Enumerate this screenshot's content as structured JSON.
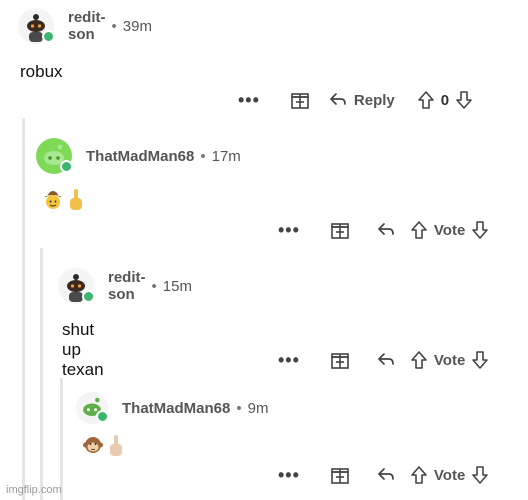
{
  "comments": [
    {
      "username": "redit-son",
      "separator": "•",
      "time": "39m",
      "text": "robux",
      "more": "•••",
      "reply_label": "Reply",
      "score": "0"
    },
    {
      "username": "ThatMadMan68",
      "separator": "•",
      "time": "17m",
      "emoji": [
        "cowboy-face",
        "middle-finger"
      ],
      "more": "•••",
      "vote_label": "Vote"
    },
    {
      "username": "redit-son",
      "separator": "•",
      "time": "15m",
      "text": "shut up texan",
      "more": "•••",
      "vote_label": "Vote"
    },
    {
      "username": "ThatMadMan68",
      "separator": "•",
      "time": "9m",
      "emoji": [
        "monkey-face",
        "middle-finger"
      ],
      "more": "•••",
      "vote_label": "Vote"
    }
  ],
  "watermark": "imgflip.com",
  "colors": {
    "online": "#3cb66d",
    "thread_line": "#e5e5e5",
    "accent_green": "#7ed957"
  }
}
